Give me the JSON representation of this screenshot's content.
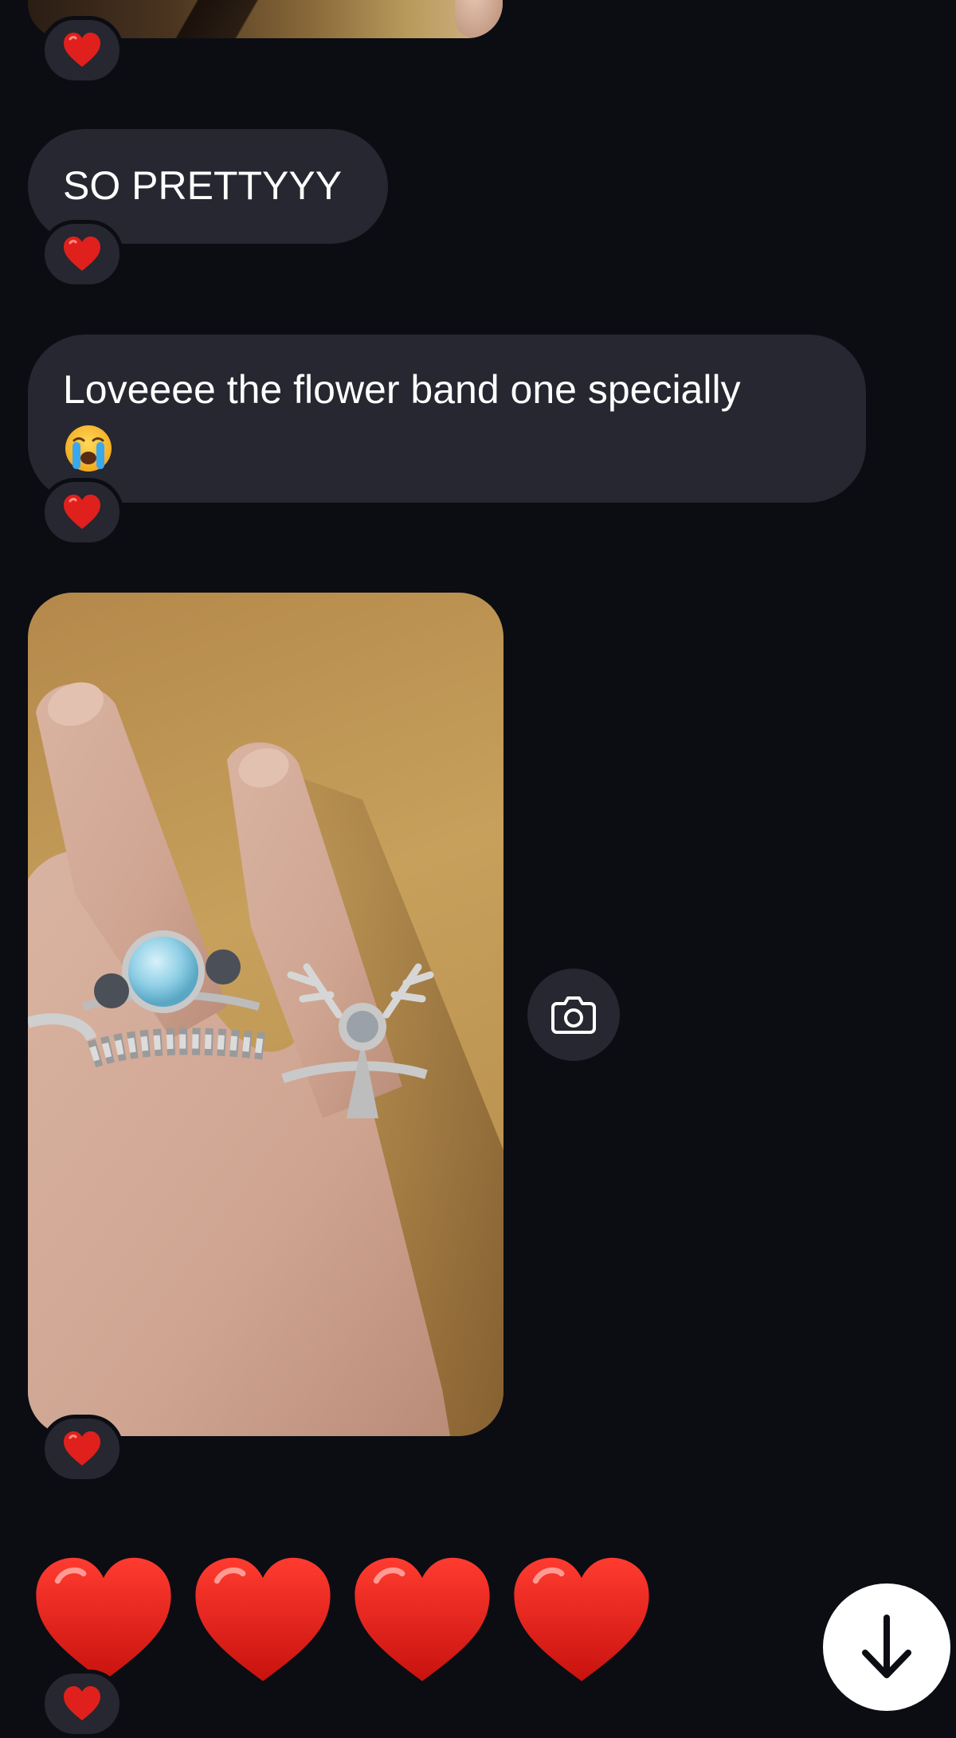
{
  "messages": [
    {
      "type": "image",
      "description_visible": false,
      "reaction": "red-heart"
    },
    {
      "type": "text",
      "text": "SO PRETTYYY",
      "reaction": "red-heart"
    },
    {
      "type": "text",
      "text": "Loveeee the flower band one specially",
      "emoji": "loudly-crying-face",
      "reaction": "red-heart"
    },
    {
      "type": "image",
      "reaction": "red-heart",
      "actions": [
        "camera-icon"
      ]
    },
    {
      "type": "emoji-only",
      "emojis": [
        "red-heart",
        "red-heart",
        "red-heart",
        "red-heart"
      ],
      "reaction": "red-heart"
    }
  ],
  "controls": {
    "scroll_to_bottom_icon": "arrow-down-icon"
  },
  "colors": {
    "background": "#0b0d13",
    "bubble": "#262730",
    "text": "#ffffff",
    "heart": "#e0201c"
  }
}
